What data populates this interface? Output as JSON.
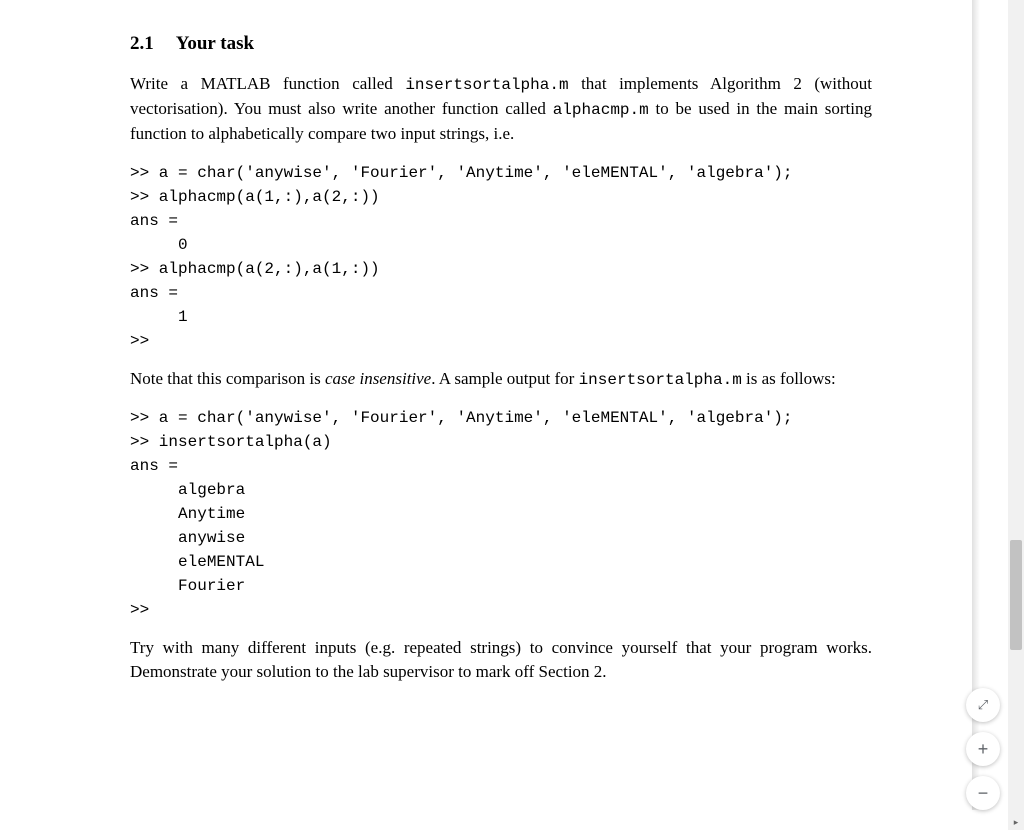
{
  "heading": {
    "num": "2.1",
    "title": "Your task"
  },
  "para1_a": "Write a MATLAB function called ",
  "para1_code1": "insertsortalpha.m",
  "para1_b": " that implements Algorithm 2 (without vectorisation). You must also write another function called ",
  "para1_code2": "alphacmp.m",
  "para1_c": " to be used in the main sorting function to alphabetically compare two input strings, i.e.",
  "code1": ">> a = char('anywise', 'Fourier', 'Anytime', 'eleMENTAL', 'algebra');\n>> alphacmp(a(1,:),a(2,:))\nans =\n     0\n>> alphacmp(a(2,:),a(1,:))\nans =\n     1\n>>",
  "para2_a": "Note that this comparison is ",
  "para2_em": "case insensitive",
  "para2_b": ". A sample output for ",
  "para2_code": "insertsortalpha.m",
  "para2_c": " is as follows:",
  "code2": ">> a = char('anywise', 'Fourier', 'Anytime', 'eleMENTAL', 'algebra');\n>> insertsortalpha(a)\nans =\n     algebra\n     Anytime\n     anywise\n     eleMENTAL\n     Fourier\n>>",
  "para3": "Try with many different inputs (e.g. repeated strings) to convince yourself that your program works. Demonstrate your solution to the lab supervisor to mark off Section 2.",
  "controls": {
    "fit": "⤢",
    "plus": "+",
    "minus": "−",
    "arrow": "▸"
  }
}
